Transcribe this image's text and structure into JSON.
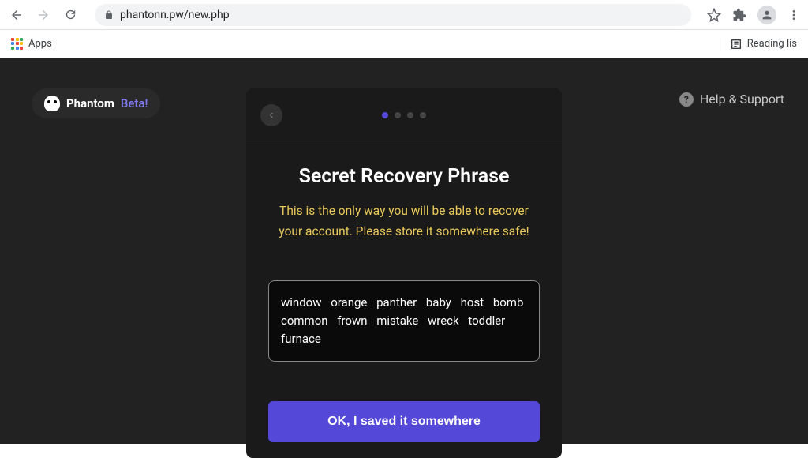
{
  "browser": {
    "url": "phantonn.pw/new.php",
    "bookmarks": {
      "apps": "Apps",
      "readingList": "Reading lis"
    }
  },
  "brand": {
    "name": "Phantom",
    "tag": "Beta!"
  },
  "help": {
    "label": "Help & Support"
  },
  "modal": {
    "title": "Secret Recovery Phrase",
    "subtitle": "This is the only way you will be able to recover your account. Please store it somewhere safe!",
    "phrase": "window orange panther baby host bomb common frown mistake wreck toddler furnace",
    "button": "OK, I saved it somewhere",
    "activeStep": 0,
    "totalSteps": 4
  }
}
